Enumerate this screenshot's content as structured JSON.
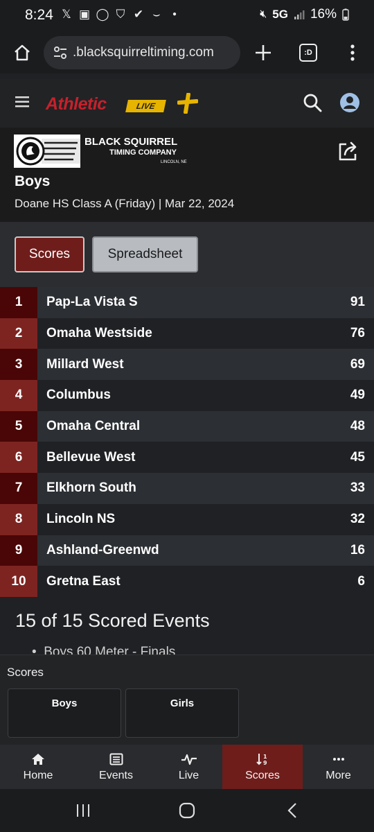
{
  "status_bar": {
    "time": "8:24",
    "network": "5G",
    "battery": "16%"
  },
  "browser": {
    "url": ".blacksquirreltiming.com",
    "tabs_count": ":D"
  },
  "site": {
    "brand": "Athletic",
    "brand_badge": "LIVE"
  },
  "event": {
    "timer_name_line1": "BLACK SQUIRREL",
    "timer_name_line2": "TIMING COMPANY",
    "timer_location": "LINCOLN, NE",
    "title": "Boys",
    "subtitle": "Doane HS Class A (Friday) | Mar 22, 2024"
  },
  "tabs": [
    {
      "label": "Scores",
      "active": true
    },
    {
      "label": "Spreadsheet",
      "active": false
    }
  ],
  "standings": [
    {
      "rank": "1",
      "team": "Pap-La Vista S",
      "points": "91"
    },
    {
      "rank": "2",
      "team": "Omaha Westside",
      "points": "76"
    },
    {
      "rank": "3",
      "team": "Millard West",
      "points": "69"
    },
    {
      "rank": "4",
      "team": "Columbus",
      "points": "49"
    },
    {
      "rank": "5",
      "team": "Omaha Central",
      "points": "48"
    },
    {
      "rank": "6",
      "team": "Bellevue West",
      "points": "45"
    },
    {
      "rank": "7",
      "team": "Elkhorn South",
      "points": "33"
    },
    {
      "rank": "8",
      "team": "Lincoln NS",
      "points": "32"
    },
    {
      "rank": "9",
      "team": "Ashland-Greenwd",
      "points": "16"
    },
    {
      "rank": "10",
      "team": "Gretna East",
      "points": "6"
    }
  ],
  "scored_events": {
    "title": "15 of 15 Scored Events",
    "first_event": "Boys 60 Meter - Finals"
  },
  "drawer": {
    "title": "Scores",
    "options": [
      "Boys",
      "Girls"
    ]
  },
  "bottom_nav": [
    {
      "label": "Home",
      "icon": "home-icon"
    },
    {
      "label": "Events",
      "icon": "list-icon"
    },
    {
      "label": "Live",
      "icon": "pulse-icon"
    },
    {
      "label": "Scores",
      "icon": "sort-icon",
      "active": true
    },
    {
      "label": "More",
      "icon": "more-icon"
    }
  ],
  "colors": {
    "accent": "#6f1d1b",
    "rank_dark": "#4a0606",
    "rank_light": "#7d2421",
    "row_dark": "#1f2124",
    "row_light": "#2c2f33",
    "brand_red": "#c8202a",
    "brand_yellow": "#e7b400"
  }
}
